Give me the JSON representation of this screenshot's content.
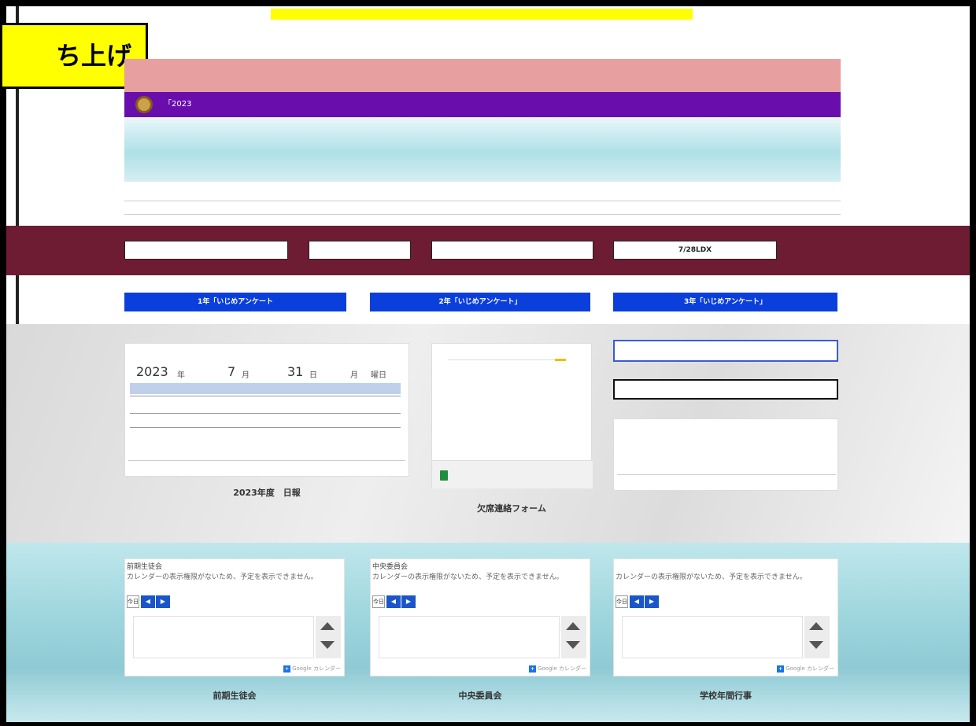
{
  "header": {
    "top_banner": "",
    "callout": "ち上げ"
  },
  "hero": {
    "pink_text": "",
    "purple_title": "「2023　",
    "wave_line1": "",
    "wave_line2": ""
  },
  "link_buttons": [
    {
      "label": ""
    },
    {
      "label": ""
    },
    {
      "label": ""
    },
    {
      "label": "7/28LDX"
    }
  ],
  "survey_buttons": [
    {
      "label": "1年「いじめアンケート"
    },
    {
      "label": "2年「いじめアンケート」"
    },
    {
      "label": "3年「いじめアンケート」"
    }
  ],
  "daily_report": {
    "header": "",
    "year": "2023",
    "year_unit": "年",
    "month": "7",
    "month_unit": "月",
    "day": "31",
    "day_unit": "日",
    "weekday": "月",
    "weekday_unit": "曜日",
    "selected_row": "",
    "row2": "",
    "row3": "",
    "tabs": [
      "",
      "",
      "",
      "",
      "",
      "",
      "",
      "",
      "",
      ""
    ],
    "caption": "2023年度　日報"
  },
  "form_card": {
    "file_label": "",
    "caption": "欠席連絡フォーム"
  },
  "right_column": {
    "button1": "",
    "button2": "",
    "note": "",
    "tabs": [
      "",
      "",
      "",
      "",
      "",
      ""
    ]
  },
  "calendars": [
    {
      "title": "前期生徒会",
      "message": "カレンダーの表示権限がないため、予定を表示できません。",
      "today_label": "今日",
      "nav_label": "",
      "list_text": "",
      "list_link": "",
      "google_label": "Google カレンダー",
      "caption": "前期生徒会"
    },
    {
      "title": "中央委員会",
      "message": "カレンダーの表示権限がないため、予定を表示できません。",
      "today_label": "今日",
      "nav_label": "",
      "list_text": "",
      "list_link": "",
      "google_label": "Google カレンダー",
      "caption": "中央委員会"
    },
    {
      "title": "",
      "message": "カレンダーの表示権限がないため、予定を表示できません。",
      "today_label": "今日",
      "nav_label": "",
      "list_text": "",
      "list_link": "",
      "google_label": "Google カレンダー",
      "caption": "学校年間行事"
    }
  ],
  "colors": {
    "maroon": "#6e1c33",
    "purple": "#6a0dad",
    "pink": "#e79f9f",
    "blue_button": "#0b3fdc",
    "highlight_yellow": "#ffff00"
  },
  "icons": {
    "school_logo": "school-logo-icon",
    "sheet": "google-sheets-icon",
    "up": "scroll-up-icon",
    "down": "scroll-down-icon"
  }
}
